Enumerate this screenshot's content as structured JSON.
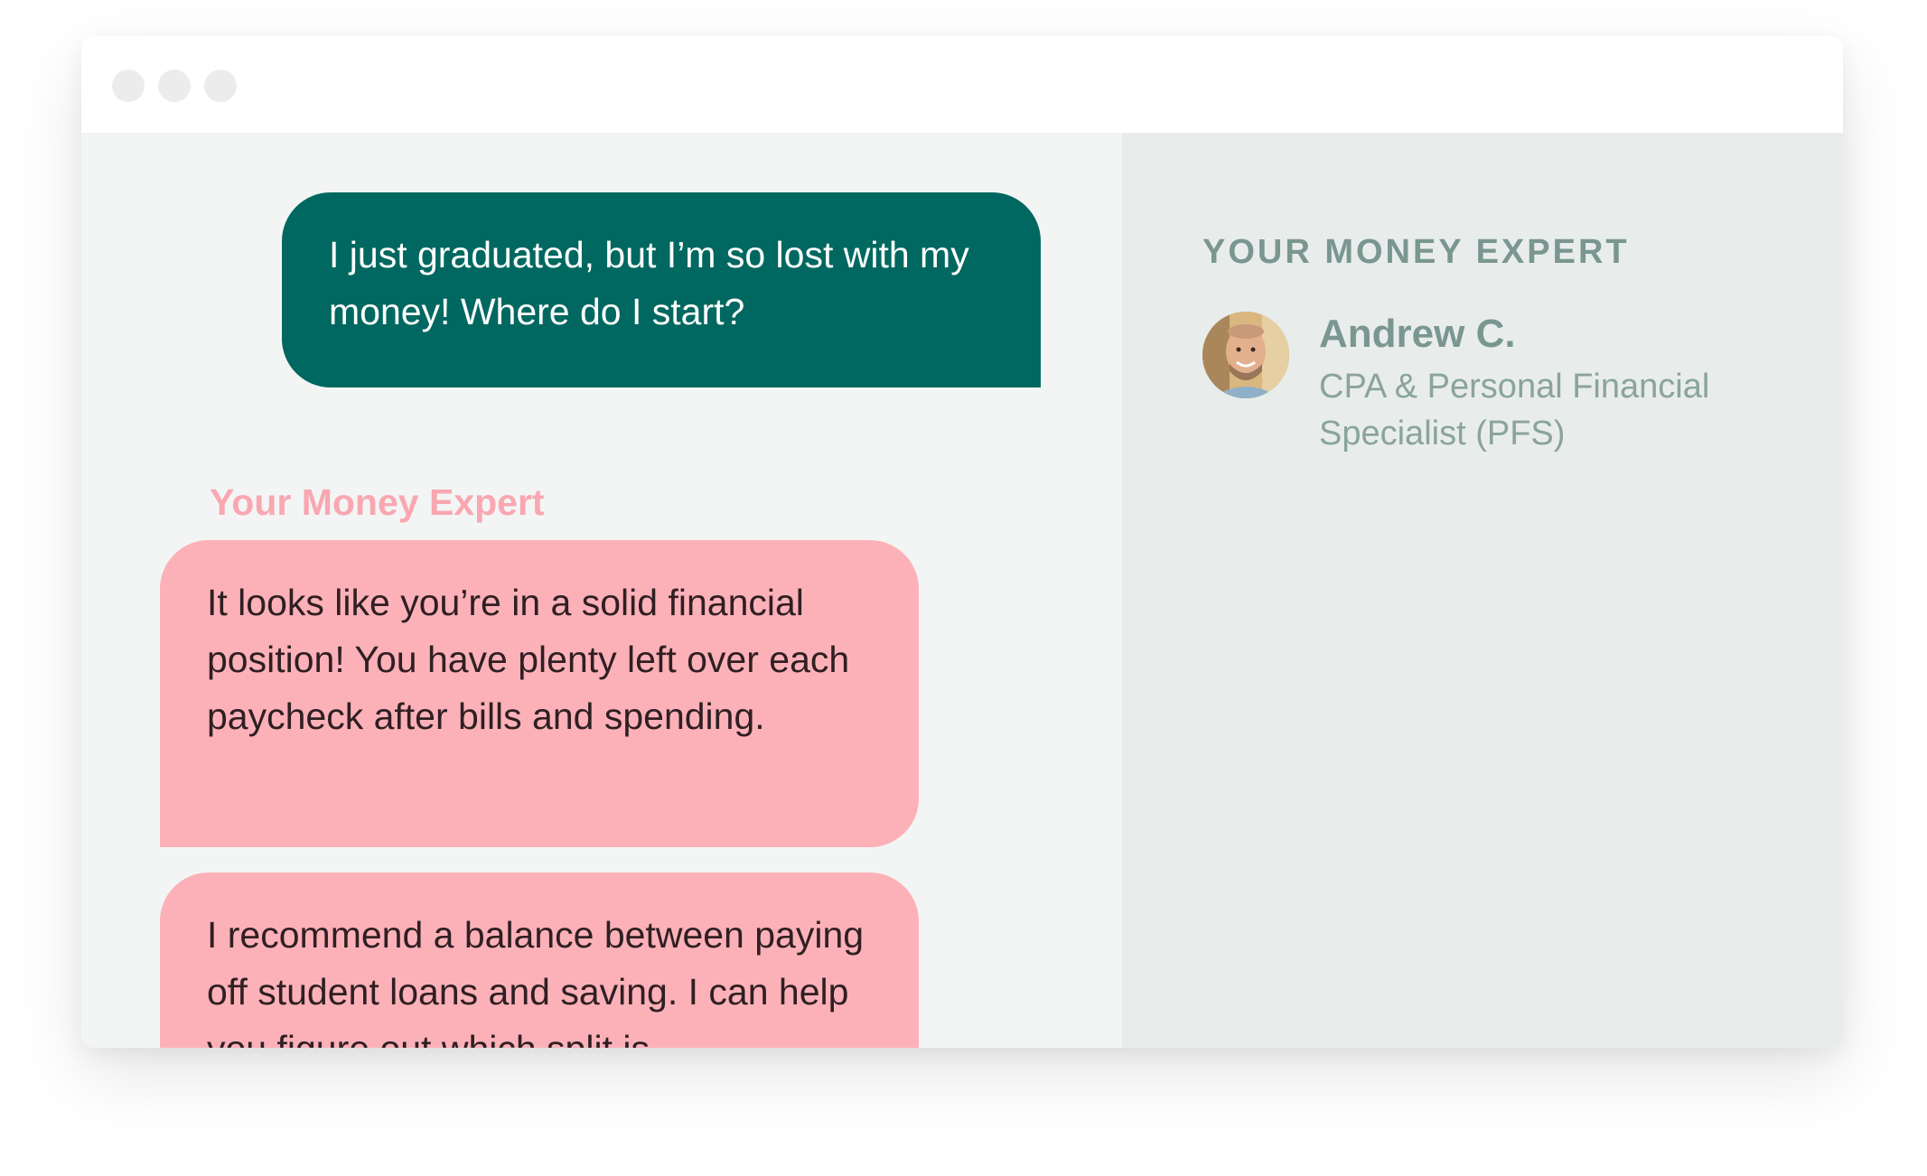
{
  "window": {
    "controls": [
      "window-dot",
      "window-dot",
      "window-dot"
    ]
  },
  "chat": {
    "user_message": "I just graduated, but I’m so lost with my money! Where do I start?",
    "expert_label": "Your Money Expert",
    "expert_messages": [
      "It looks like you’re in a solid financial position! You have plenty left over each paycheck after bills and spending.",
      "I recommend a balance between paying off student loans and saving. I can help you figure out which split is"
    ]
  },
  "sidebar": {
    "heading": "YOUR MONEY EXPERT",
    "expert": {
      "name": "Andrew C.",
      "title": "CPA & Personal Financial Specialist (PFS)",
      "avatar_icon": "person-photo-avatar"
    }
  },
  "colors": {
    "user_bubble": "#006860",
    "expert_bubble": "#fcb1b9",
    "expert_label": "#f9a7b1",
    "sidebar_text": "#7a9690",
    "chat_bg": "#f3f5f4",
    "sidebar_bg": "#e8edeb"
  }
}
